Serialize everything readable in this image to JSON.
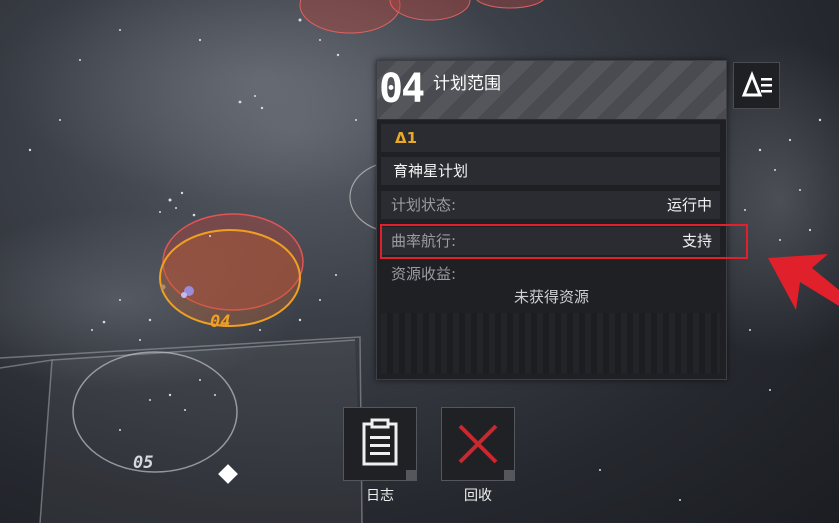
{
  "map": {
    "sector_labels": [
      "04",
      "05"
    ]
  },
  "panel": {
    "number": "04",
    "title": "计划范围",
    "tier": "Δ1",
    "plan_name": "育神星计划",
    "status_label": "计划状态:",
    "status_value": "运行中",
    "warp_label": "曲率航行:",
    "warp_value": "支持",
    "resource_label": "资源收益:",
    "resource_value": "未获得资源"
  },
  "actions": {
    "log_label": "日志",
    "recall_label": "回收"
  },
  "colors": {
    "tier_accent": "#e8a928",
    "highlight_red": "#e0202a",
    "recall_x": "#c8282e",
    "orbit_orange": "#f0a020"
  },
  "icons": {
    "menu": "menu-list-icon",
    "log": "clipboard-icon",
    "recall": "x-cross-icon"
  }
}
